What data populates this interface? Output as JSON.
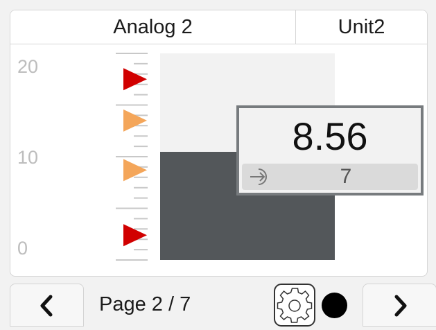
{
  "header": {
    "channel_name": "Analog 2",
    "unit": "Unit2"
  },
  "scale": {
    "max_label": "20",
    "mid_label": "10",
    "min_label": "0",
    "min": 0,
    "max": 20
  },
  "gauge": {
    "fill_value": 10.5,
    "fill_color": "#53575a",
    "background_color": "#f2f2f2",
    "alarm_markers": [
      {
        "value": 17.5,
        "color": "#d10000",
        "level": "high-high"
      },
      {
        "value": 13.5,
        "color": "#f4a65a",
        "level": "high"
      },
      {
        "value": 8.7,
        "color": "#f4a65a",
        "level": "low"
      },
      {
        "value": 2.4,
        "color": "#d10000",
        "level": "low-low"
      }
    ]
  },
  "reading": {
    "value": "8.56",
    "setpoint_icon": "arrow-into-circle-icon",
    "setpoint": "7"
  },
  "footer": {
    "prev_icon": "chevron-left-icon",
    "page_label": "Page 2 / 7",
    "settings_icon": "gear-icon",
    "status_icon": "status-dot-icon",
    "status_color": "#000000",
    "next_icon": "chevron-right-icon"
  }
}
